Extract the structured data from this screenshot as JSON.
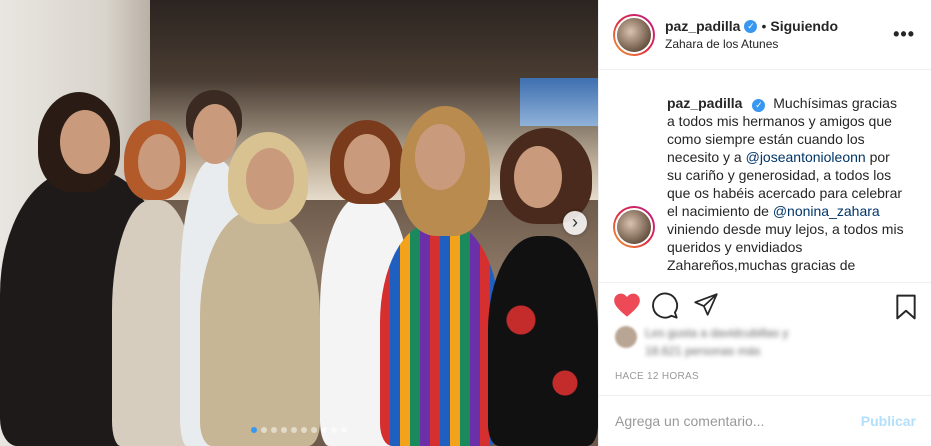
{
  "header": {
    "username": "paz_padilla",
    "separator": "•",
    "follow_status": "Siguiendo",
    "location": "Zahara de los Atunes",
    "more_icon": "more-horizontal-icon"
  },
  "caption": {
    "username": "paz_padilla",
    "segments": [
      "Muchísimas gracias a todos mis hermanos y amigos que como siempre están cuando los necesito y a ",
      "@joseantonioleonn",
      " por su cariño y generosidad, a todos los que os habéis acercado para celebrar el nacimiento de ",
      "@nonina_zahara",
      " viniendo desde muy lejos, a todos mis queridos y envidiados Zahareños,muchas gracias de"
    ]
  },
  "likes": {
    "line1": "Les gusta a davidcubillas y",
    "line2": "18.621 personas más"
  },
  "timestamp": "HACE 12 HORAS",
  "comment": {
    "placeholder": "Agrega un comentario...",
    "publish_label": "Publicar"
  },
  "carousel": {
    "slide_count": 10,
    "active_index": 0,
    "next_icon": "chevron-right-icon"
  },
  "colors": {
    "like_active": "#ed4956",
    "verified": "#3897f0",
    "mention": "#003569",
    "publish_disabled": "#b2dffc"
  }
}
